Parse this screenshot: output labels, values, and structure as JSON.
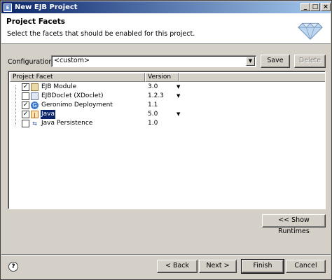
{
  "window": {
    "title": "New EJB Project"
  },
  "header": {
    "title": "Project Facets",
    "subtitle": "Select the facets that should be enabled for this project."
  },
  "configurations": {
    "label": "Configurations:",
    "value": "<custom>",
    "save_label": "Save",
    "delete_label": "Delete"
  },
  "table": {
    "columns": [
      "Project Facet",
      "Version"
    ],
    "rows": [
      {
        "checked": true,
        "name": "EJB Module",
        "version": "3.0",
        "dropdown": true,
        "icon": "ejb-module-icon"
      },
      {
        "checked": false,
        "name": "EJBDoclet (XDoclet)",
        "version": "1.2.3",
        "dropdown": true,
        "icon": "ejbdoclet-icon"
      },
      {
        "checked": true,
        "name": "Geronimo Deployment",
        "version": "1.1",
        "dropdown": false,
        "icon": "geronimo-icon"
      },
      {
        "checked": true,
        "name": "Java",
        "version": "5.0",
        "dropdown": true,
        "icon": "java-icon",
        "selected": true
      },
      {
        "checked": false,
        "name": "Java Persistence",
        "version": "1.0",
        "dropdown": false,
        "icon": "java-persistence-icon"
      }
    ]
  },
  "buttons": {
    "show_runtimes": "<< Show Runtimes",
    "back": "< Back",
    "next": "Next >",
    "finish": "Finish",
    "cancel": "Cancel"
  },
  "colors": {
    "title_bar": "#0a246a",
    "selection": "#0a246a",
    "dialog_bg": "#d4d0c8"
  }
}
